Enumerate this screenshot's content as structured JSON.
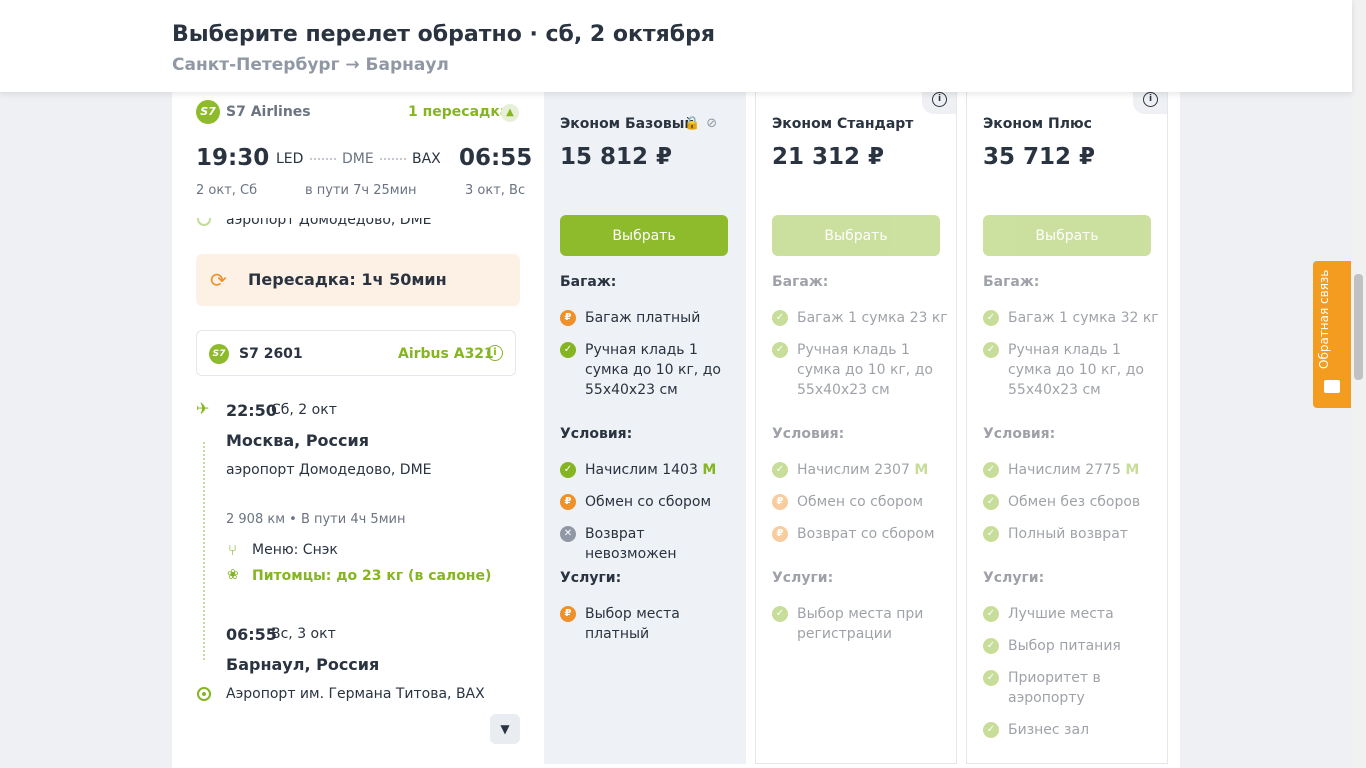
{
  "header": {
    "title": "Выберите перелет обратно · сб, 2 октября",
    "subtitle": "Санкт-Петербург → Барнаул"
  },
  "flight": {
    "airline_logo": "S7",
    "airline": "S7 Airlines",
    "stops": "1 пересадка",
    "dep_time": "19:30",
    "arr_time": "06:55",
    "codes": [
      "LED",
      "DME",
      "BAX"
    ],
    "dep_date": "2 окт, Сб",
    "duration": "в пути 7ч 25мин",
    "arr_date": "3 окт, Вс",
    "prev_airport": "аэропорт Домодедово, DME",
    "transfer": "Пересадка: 1ч 50мин",
    "segment": {
      "flight_number": "S7 2601",
      "aircraft": "Airbus A321",
      "dep_time": "22:50",
      "dep_day": "Сб, 2 окт",
      "dep_city": "Москва, Россия",
      "dep_airport": "аэропорт Домодедово, DME",
      "distance": "2 908 км  •  В пути 4ч 5мин",
      "meal": "Меню: Снэк",
      "pets": "Питомцы: до 23 кг (в салоне)",
      "arr_time": "06:55",
      "arr_day": "Вс, 3 окт",
      "arr_city": "Барнаул, Россия",
      "arr_airport": "Аэропорт им. Германа Титова, BAX"
    }
  },
  "fares": [
    {
      "name": "Эконом Базовый",
      "price": "15 812 ₽",
      "button": "Выбрать",
      "baggage_title": "Багаж:",
      "baggage": [
        "Багаж платный",
        "Ручная кладь 1 сумка до 10 кг, до 55x40x23 см"
      ],
      "conditions_title": "Условия:",
      "miles_text": "Начислим 1403",
      "conditions": [
        "Обмен со сбором",
        "Возврат невозможен"
      ],
      "services_title": "Услуги:",
      "services": [
        "Выбор места платный"
      ]
    },
    {
      "name": "Эконом Стандарт",
      "price": "21 312 ₽",
      "button": "Выбрать",
      "baggage_title": "Багаж:",
      "baggage": [
        "Багаж 1 сумка 23 кг",
        "Ручная кладь 1 сумка до 10 кг, до 55x40x23 см"
      ],
      "conditions_title": "Условия:",
      "miles_text": "Начислим 2307",
      "conditions": [
        "Обмен со сбором",
        "Возврат со сбором"
      ],
      "services_title": "Услуги:",
      "services": [
        "Выбор места при регистрации"
      ]
    },
    {
      "name": "Эконом Плюс",
      "price": "35 712 ₽",
      "button": "Выбрать",
      "baggage_title": "Багаж:",
      "baggage": [
        "Багаж 1 сумка 32 кг",
        "Ручная кладь 1 сумка до 10 кг, до 55x40x23 см"
      ],
      "conditions_title": "Условия:",
      "miles_text": "Начислим 2775",
      "conditions": [
        "Обмен без сборов",
        "Полный возврат"
      ],
      "services_title": "Услуги:",
      "services": [
        "Лучшие места",
        "Выбор питания",
        "Приоритет в аэропорту",
        "Бизнес зал"
      ]
    }
  ],
  "feedback": "Обратная связь",
  "colors": {
    "brand": "#86b522",
    "pay": "#f0902a",
    "feedback": "#f39c1f"
  }
}
